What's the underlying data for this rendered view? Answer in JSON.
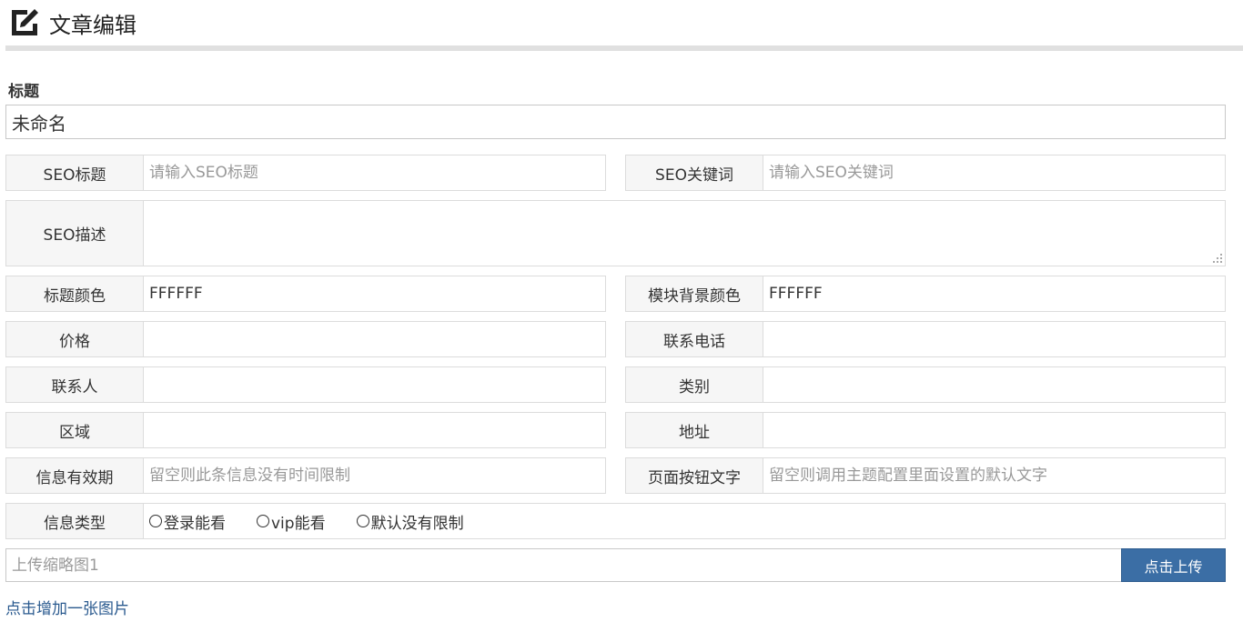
{
  "header": {
    "title": "文章编辑",
    "icon": "edit-icon"
  },
  "title_field": {
    "label": "标题",
    "value": "未命名"
  },
  "seo_title": {
    "label": "SEO标题",
    "placeholder": "请输入SEO标题"
  },
  "seo_keywords": {
    "label": "SEO关键词",
    "placeholder": "请输入SEO关键词"
  },
  "seo_description": {
    "label": "SEO描述",
    "placeholder": ""
  },
  "title_color": {
    "label": "标题颜色",
    "value": "FFFFFF"
  },
  "block_bg_color": {
    "label": "模块背景颜色",
    "value": "FFFFFF"
  },
  "price": {
    "label": "价格",
    "value": ""
  },
  "phone": {
    "label": "联系电话",
    "value": ""
  },
  "contact": {
    "label": "联系人",
    "value": ""
  },
  "category": {
    "label": "类别",
    "value": ""
  },
  "region": {
    "label": "区域",
    "value": ""
  },
  "address": {
    "label": "地址",
    "value": ""
  },
  "validity": {
    "label": "信息有效期",
    "placeholder": "留空则此条信息没有时间限制"
  },
  "button_text": {
    "label": "页面按钮文字",
    "placeholder": "留空则调用主题配置里面设置的默认文字"
  },
  "info_type": {
    "label": "信息类型",
    "options": [
      "登录能看",
      "vip能看",
      "默认没有限制"
    ]
  },
  "upload": {
    "placeholder": "上传缩略图1",
    "button": "点击上传"
  },
  "add_image_link": "点击增加一张图片",
  "colors": {
    "primary_button": "#3b6ea5",
    "link": "#2a5a8f"
  }
}
